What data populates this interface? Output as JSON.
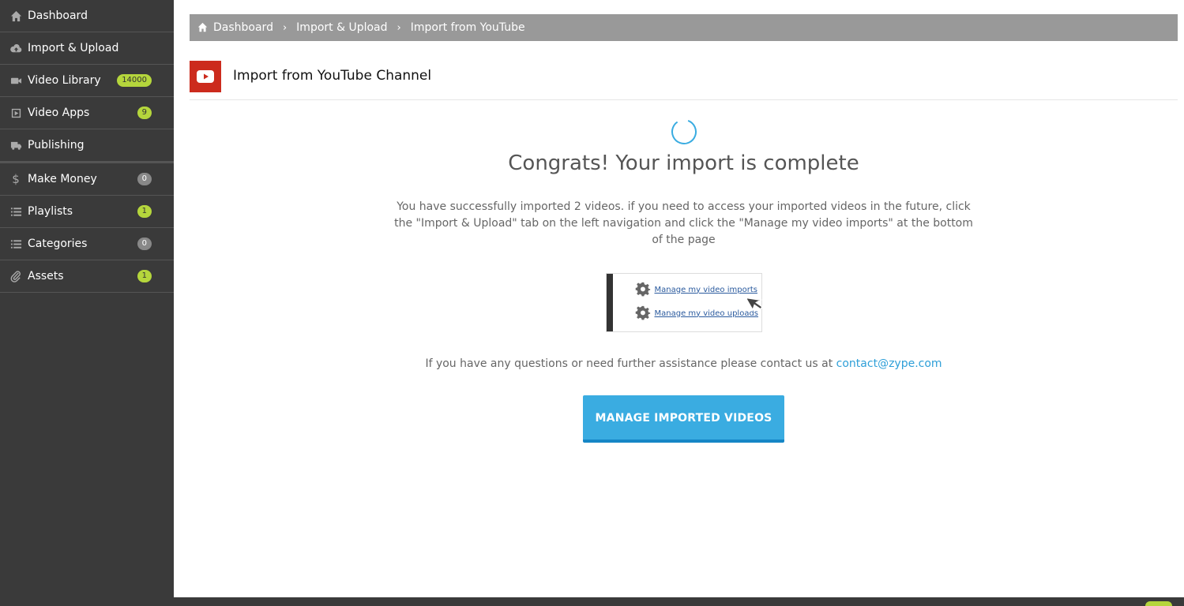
{
  "sidebar": {
    "items": [
      {
        "label": "Dashboard",
        "icon": "home-icon",
        "badge": ""
      },
      {
        "label": "Import & Upload",
        "icon": "cloud-upload-icon",
        "badge": ""
      },
      {
        "label": "Video Library",
        "icon": "video-camera-icon",
        "badge": "14000"
      },
      {
        "label": "Video Apps",
        "icon": "play-square-icon",
        "badge": "9"
      },
      {
        "label": "Publishing",
        "icon": "truck-icon",
        "badge": ""
      },
      {
        "label": "Make Money",
        "icon": "dollar-icon",
        "badge": "0"
      },
      {
        "label": "Playlists",
        "icon": "list-icon",
        "badge": "1"
      },
      {
        "label": "Categories",
        "icon": "list-icon",
        "badge": "0"
      },
      {
        "label": "Assets",
        "icon": "paperclip-icon",
        "badge": "1"
      }
    ]
  },
  "breadcrumb": {
    "items": [
      "Dashboard",
      "Import & Upload",
      "Import from YouTube"
    ]
  },
  "header": {
    "title": "Import from YouTube Channel"
  },
  "main": {
    "heading": "Congrats! Your import is complete",
    "description": "You have successfully imported 2 videos. if you need to access your imported videos in the future, click the \"Import & Upload\" tab on the left navigation and click the \"Manage my video imports\" at the bottom of the page",
    "hint_links": [
      "Manage my video imports",
      "Manage my video uploads"
    ],
    "contact_text": "If you have any questions or need further assistance please contact us at",
    "contact_email": "contact@zype.com",
    "button_label": "MANAGE IMPORTED VIDEOS"
  },
  "colors": {
    "sidebar_bg": "#3a3a3a",
    "badge_green": "#b5d63c",
    "badge_gray": "#888888",
    "accent_blue": "#3aace1",
    "youtube_red": "#cc2b1d"
  }
}
